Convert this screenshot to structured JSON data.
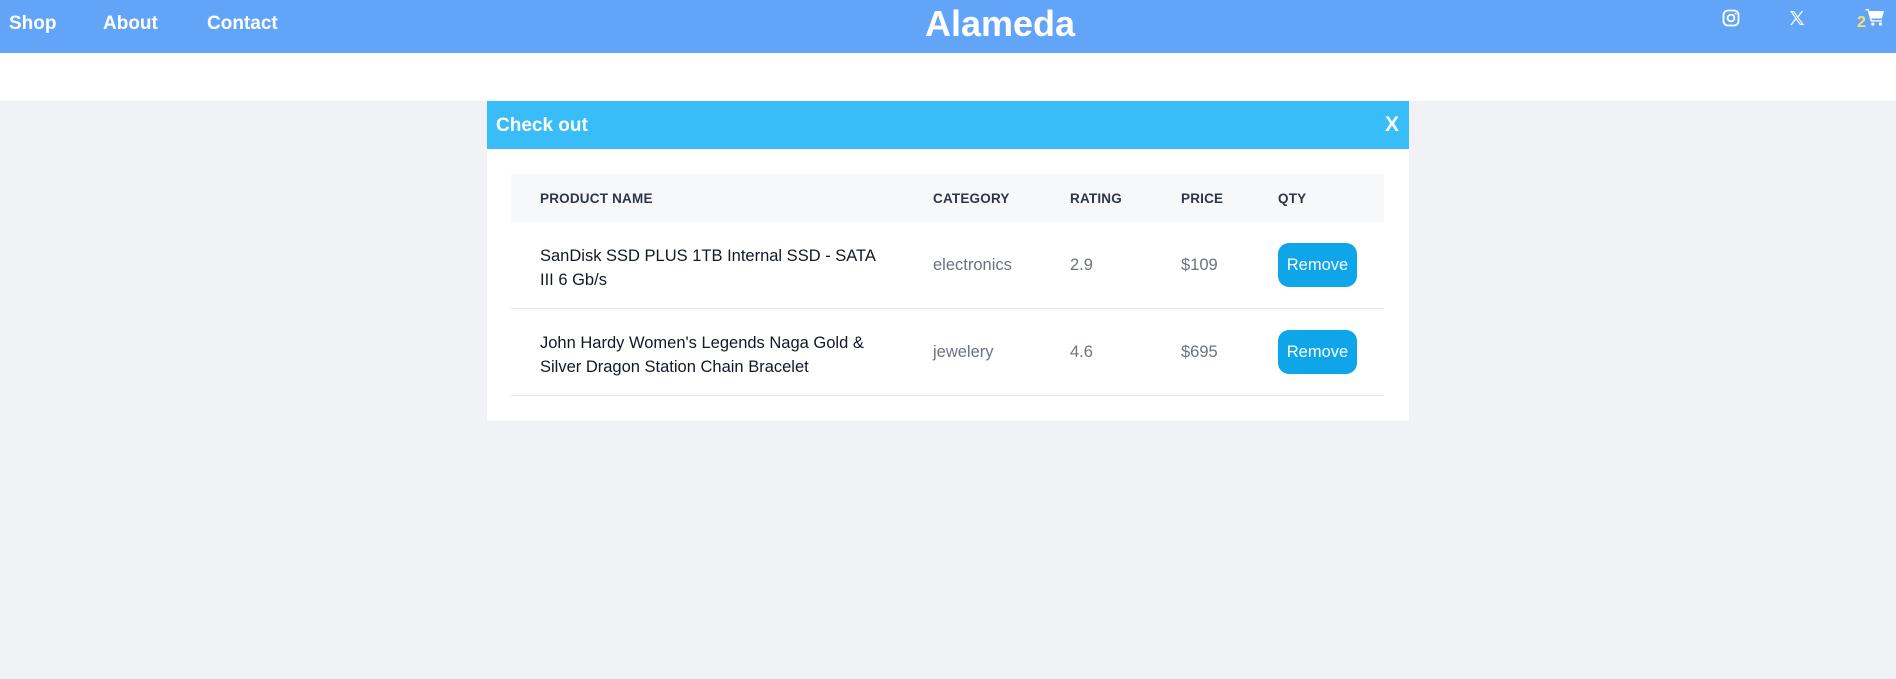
{
  "nav": {
    "links": [
      "Shop",
      "About",
      "Contact"
    ],
    "brand": "Alameda",
    "cart_count": "2",
    "icons": [
      "instagram-icon",
      "x-twitter-icon",
      "cart-icon"
    ]
  },
  "modal": {
    "title": "Check out",
    "close_label": "X"
  },
  "table": {
    "headers": [
      "Product Name",
      "Category",
      "Rating",
      "Price",
      "Qty"
    ],
    "rows": [
      {
        "name": "SanDisk SSD PLUS 1TB Internal SSD - SATA III 6 Gb/s",
        "category": "electronics",
        "rating": "2.9",
        "price": "$109",
        "action": "Remove"
      },
      {
        "name": "John Hardy Women's Legends Naga Gold & Silver Dragon Station Chain Bracelet",
        "category": "jewelery",
        "rating": "4.6",
        "price": "$695",
        "action": "Remove"
      }
    ]
  },
  "colors": {
    "nav_bg": "#62a5f8",
    "modal_header_bg": "#38bdf8",
    "button_bg": "#0ea5e9",
    "cart_count": "#f7e36c",
    "page_bg": "#f0f2f6"
  }
}
